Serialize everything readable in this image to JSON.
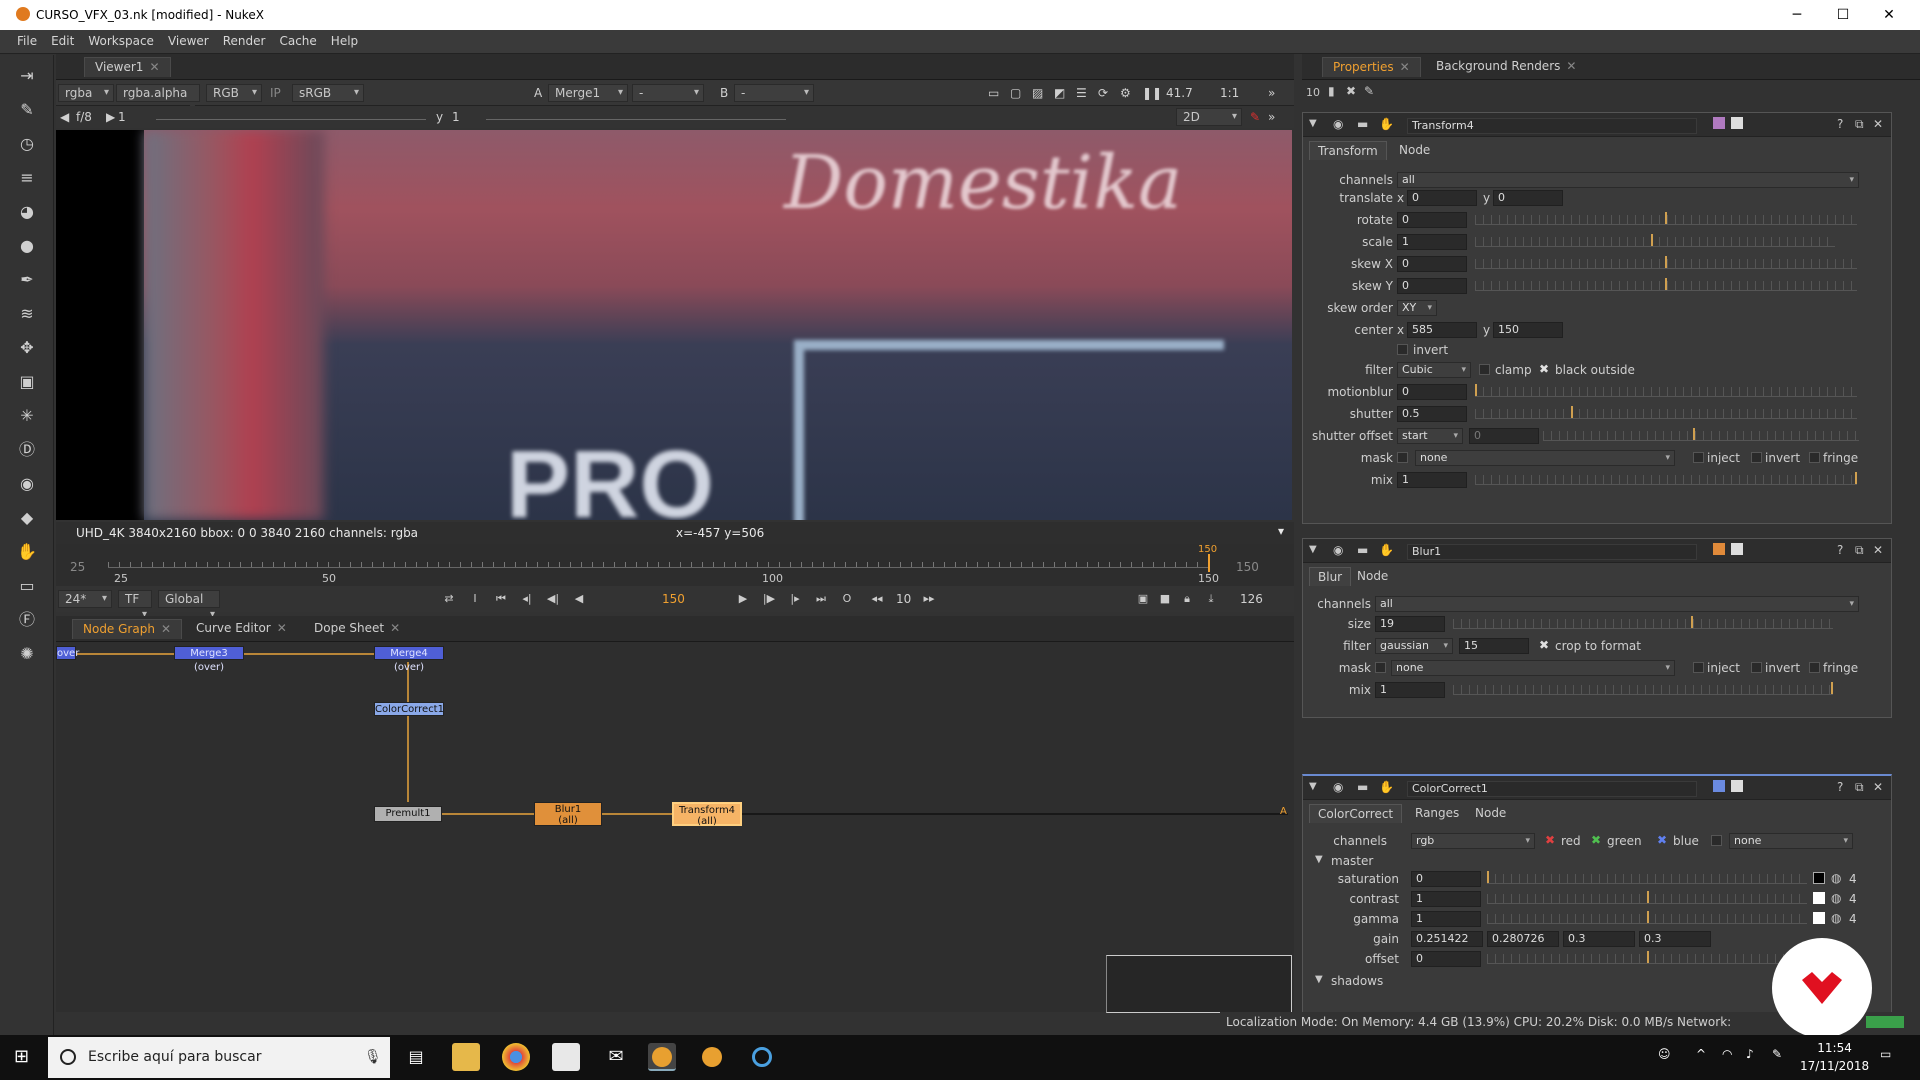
{
  "window": {
    "title": "CURSO_VFX_03.nk [modified] - NukeX"
  },
  "menu": [
    "File",
    "Edit",
    "Workspace",
    "Viewer",
    "Render",
    "Cache",
    "Help"
  ],
  "viewer": {
    "tab": "Viewer1",
    "channels": "rgba",
    "alpha": "rgba.alpha",
    "display": "RGB",
    "ip": "IP",
    "lut": "sRGB",
    "input_a_label": "A",
    "input_a": "Merge1",
    "input_mid": "-",
    "input_b_label": "B",
    "input_b": "-",
    "zoom": "41.7",
    "ratio": "1:1",
    "mode": "2D",
    "fstop": "f/8",
    "gain": "1",
    "y_label": "y",
    "gamma": "1",
    "info": "UHD_4K 3840x2160  bbox: 0 0 3840 2160 channels: rgba",
    "coords": "x=-457 y=506",
    "image_text_1": "Domestika",
    "image_text_2": "PRO"
  },
  "timeline": {
    "start": "25",
    "end": "150",
    "ticks": [
      "25",
      "50",
      "100",
      "150"
    ],
    "current": "150",
    "fps": "24*",
    "tf": "TF",
    "global": "Global",
    "frame_display": "150",
    "step": "10",
    "frame_total": "126"
  },
  "graph": {
    "tabs": [
      "Node Graph",
      "Curve Editor",
      "Dope Sheet"
    ],
    "nodes": {
      "over": "over",
      "merge3": "Merge3 (over)",
      "merge4": "Merge4 (over)",
      "colorcorrect": "ColorCorrect1",
      "premult": "Premult1",
      "blur": "Blur1",
      "blur_sub": "(all)",
      "transform": "Transform4",
      "transform_sub": "(all)"
    },
    "a_label": "A"
  },
  "right_tabs": [
    "Properties",
    "Background Renders"
  ],
  "props_count": "10",
  "transform": {
    "name": "Transform4",
    "tabs": [
      "Transform",
      "Node"
    ],
    "channels": "all",
    "translate_x": "0",
    "translate_y": "0",
    "rotate": "0",
    "scale": "1",
    "skew_x": "0",
    "skew_y": "0",
    "skew_order": "XY",
    "center_x": "585",
    "center_y": "150",
    "invert_label": "invert",
    "filter": "Cubic",
    "clamp_label": "clamp",
    "black_outside_label": "black outside",
    "motionblur": "0",
    "shutter": "0.5",
    "shutter_offset": "start",
    "shutter_offset_val": "0",
    "mask": "none",
    "inject_label": "inject",
    "invert2_label": "invert",
    "fringe_label": "fringe",
    "mix": "1",
    "labels": {
      "channels": "channels",
      "translate": "translate",
      "rotate": "rotate",
      "scale": "scale",
      "skewx": "skew X",
      "skewy": "skew Y",
      "skeworder": "skew order",
      "center": "center",
      "filter": "filter",
      "motionblur": "motionblur",
      "shutter": "shutter",
      "shutteroffset": "shutter offset",
      "mask": "mask",
      "mix": "mix",
      "x": "x",
      "y": "y"
    }
  },
  "blur": {
    "name": "Blur1",
    "tabs": [
      "Blur",
      "Node"
    ],
    "channels": "all",
    "size": "19",
    "filter": "gaussian",
    "filter_val": "15",
    "crop_label": "crop to format",
    "mask": "none",
    "mix": "1",
    "labels": {
      "channels": "channels",
      "size": "size",
      "filter": "filter",
      "mask": "mask",
      "mix": "mix"
    }
  },
  "colorcorrect": {
    "name": "ColorCorrect1",
    "tabs": [
      "ColorCorrect",
      "Ranges",
      "Node"
    ],
    "channels": "rgb",
    "red": "red",
    "green": "green",
    "blue": "blue",
    "none": "none",
    "master": "master",
    "saturation": "0",
    "contrast": "1",
    "gamma": "1",
    "gain": [
      "0.251422",
      "0.280726",
      "0.3",
      "0.3"
    ],
    "offset": "0",
    "shadows": "shadows",
    "four": "4",
    "labels": {
      "channels": "channels",
      "saturation": "saturation",
      "contrast": "contrast",
      "gamma": "gamma",
      "gain": "gain",
      "offset": "offset"
    }
  },
  "status": "Localization Mode: On Memory: 4.4 GB (13.9%) CPU: 20.2% Disk: 0.0 MB/s Network:",
  "taskbar": {
    "search": "Escribe aquí para buscar",
    "time": "11:54",
    "date": "17/11/2018"
  },
  "colors": {
    "accent": "#f0a030",
    "node_blue": "#4f5fd6",
    "node_orange": "#e0903a",
    "brand_red": "#e01020"
  }
}
